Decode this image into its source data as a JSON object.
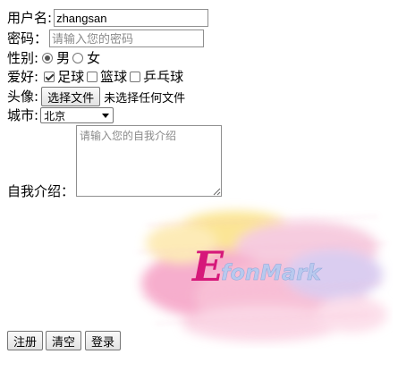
{
  "form": {
    "username": {
      "label": "用户名:",
      "value": "zhangsan"
    },
    "password": {
      "label": "密码：",
      "placeholder": "请输入您的密码"
    },
    "gender": {
      "label": "性别:",
      "options": [
        "男",
        "女"
      ],
      "selected": "男"
    },
    "hobbies": {
      "label": "爱好:",
      "options": [
        {
          "label": "足球",
          "checked": true
        },
        {
          "label": "篮球",
          "checked": false
        },
        {
          "label": "乒乓球",
          "checked": false
        }
      ]
    },
    "avatar": {
      "label": "头像:",
      "button_label": "选择文件",
      "status": "未选择任何文件"
    },
    "city": {
      "label": "城市:",
      "selected": "北京"
    },
    "intro": {
      "label": "自我介绍：",
      "placeholder": "请输入您的自我介绍"
    },
    "buttons": {
      "register": "注册",
      "clear": "清空",
      "login": "登录"
    }
  },
  "logo": {
    "text": "EfonMark",
    "colors": {
      "ink": "#d6187a",
      "wash_pink": "#f6a6c8",
      "wash_yellow": "#fbe38a",
      "wash_blue": "#b8c9ee"
    }
  }
}
